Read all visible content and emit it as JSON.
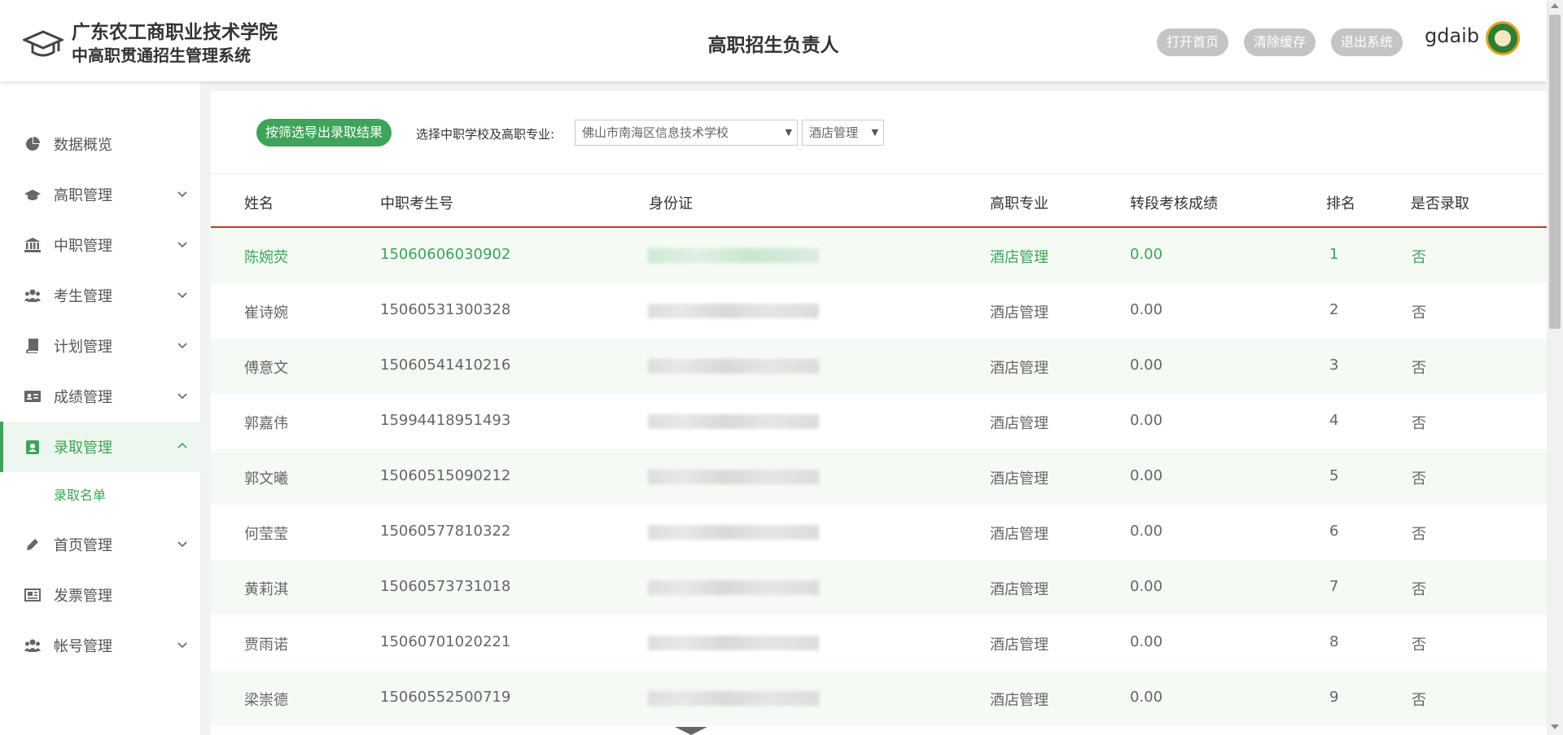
{
  "header": {
    "school_name": "广东农工商职业技术学院",
    "system_name": "中高职贯通招生管理系统",
    "role_title": "高职招生负责人",
    "buttons": [
      "打开首页",
      "清除缓存",
      "退出系统"
    ],
    "username": "gdaib"
  },
  "sidebar": {
    "items": [
      {
        "label": "数据概览",
        "icon": "pie-chart-icon",
        "has_children": false
      },
      {
        "label": "高职管理",
        "icon": "graduation-cap-icon",
        "has_children": true
      },
      {
        "label": "中职管理",
        "icon": "bank-icon",
        "has_children": true
      },
      {
        "label": "考生管理",
        "icon": "users-icon",
        "has_children": true
      },
      {
        "label": "计划管理",
        "icon": "book-icon",
        "has_children": true
      },
      {
        "label": "成绩管理",
        "icon": "id-card-icon",
        "has_children": true
      },
      {
        "label": "录取管理",
        "icon": "user-badge-icon",
        "has_children": true,
        "expanded": true,
        "active": true
      },
      {
        "label": "首页管理",
        "icon": "pencil-icon",
        "has_children": true
      },
      {
        "label": "发票管理",
        "icon": "receipt-icon",
        "has_children": false
      },
      {
        "label": "帐号管理",
        "icon": "users-icon",
        "has_children": true
      }
    ],
    "submenu": {
      "label": "录取名单"
    }
  },
  "toolbar": {
    "export_label": "按筛选导出录取结果",
    "filter_label": "选择中职学校及高职专业:",
    "school_select": "佛山市南海区信息技术学校",
    "major_select": "酒店管理"
  },
  "table": {
    "headers": [
      "姓名",
      "中职考生号",
      "身份证",
      "高职专业",
      "转段考核成绩",
      "排名",
      "是否录取"
    ],
    "rows": [
      {
        "name": "陈婉荧",
        "exam_no": "15060606030902",
        "major": "酒店管理",
        "score": "0.00",
        "rank": "1",
        "admitted": "否"
      },
      {
        "name": "崔诗婉",
        "exam_no": "15060531300328",
        "major": "酒店管理",
        "score": "0.00",
        "rank": "2",
        "admitted": "否"
      },
      {
        "name": "傅意文",
        "exam_no": "15060541410216",
        "major": "酒店管理",
        "score": "0.00",
        "rank": "3",
        "admitted": "否"
      },
      {
        "name": "郭嘉伟",
        "exam_no": "15994418951493",
        "major": "酒店管理",
        "score": "0.00",
        "rank": "4",
        "admitted": "否"
      },
      {
        "name": "郭文曦",
        "exam_no": "15060515090212",
        "major": "酒店管理",
        "score": "0.00",
        "rank": "5",
        "admitted": "否"
      },
      {
        "name": "何莹莹",
        "exam_no": "15060577810322",
        "major": "酒店管理",
        "score": "0.00",
        "rank": "6",
        "admitted": "否"
      },
      {
        "name": "黄莉淇",
        "exam_no": "15060573731018",
        "major": "酒店管理",
        "score": "0.00",
        "rank": "7",
        "admitted": "否"
      },
      {
        "name": "贾雨诺",
        "exam_no": "15060701020221",
        "major": "酒店管理",
        "score": "0.00",
        "rank": "8",
        "admitted": "否"
      },
      {
        "name": "梁崇德",
        "exam_no": "15060552500719",
        "major": "酒店管理",
        "score": "0.00",
        "rank": "9",
        "admitted": "否"
      }
    ]
  },
  "colors": {
    "accent": "#3da45a",
    "header_rule": "#c0392b",
    "button_gray": "#c4c4c4"
  }
}
